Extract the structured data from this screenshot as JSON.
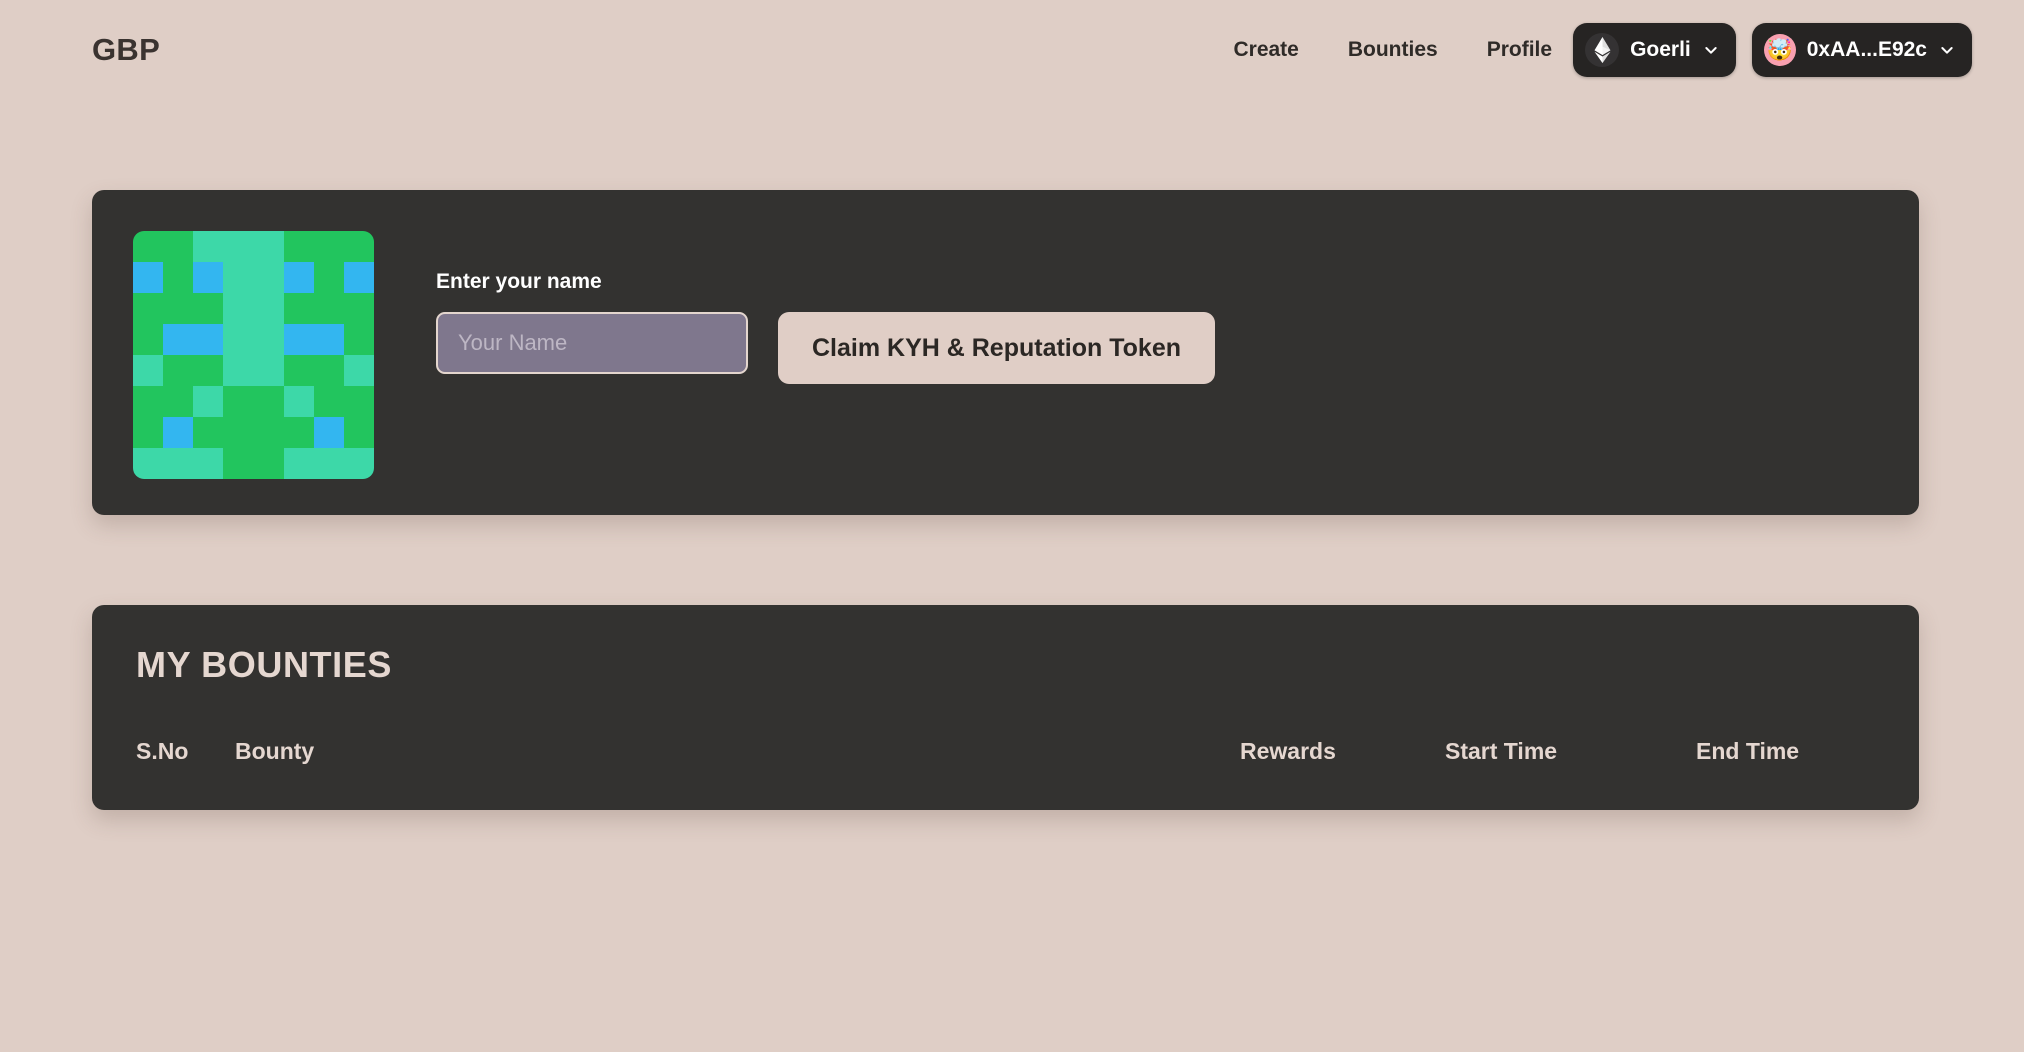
{
  "brand": {
    "name": "GBP"
  },
  "nav": {
    "links": [
      {
        "label": "Create",
        "name": "create"
      },
      {
        "label": "Bounties",
        "name": "bounties"
      },
      {
        "label": "Profile",
        "name": "profile"
      }
    ],
    "network_chip": {
      "label": "Goerli",
      "icon": "ethereum-icon",
      "chevron": "chevron-down-icon"
    },
    "account_chip": {
      "label": "0xAA...E92c",
      "avatar_emoji": "🤯",
      "chevron": "chevron-down-icon"
    }
  },
  "profile_card": {
    "identicon": {
      "colors": {
        "green": "#22c55e",
        "blue": "#33b6f0",
        "mint": "#3dd8a8"
      },
      "grid": [
        [
          "green",
          "green",
          "mint",
          "mint",
          "mint",
          "green",
          "green",
          "green"
        ],
        [
          "blue",
          "green",
          "blue",
          "mint",
          "mint",
          "blue",
          "green",
          "blue"
        ],
        [
          "green",
          "green",
          "green",
          "mint",
          "mint",
          "green",
          "green",
          "green"
        ],
        [
          "green",
          "blue",
          "blue",
          "mint",
          "mint",
          "blue",
          "blue",
          "green"
        ],
        [
          "mint",
          "green",
          "green",
          "mint",
          "mint",
          "green",
          "green",
          "mint"
        ],
        [
          "green",
          "green",
          "mint",
          "green",
          "green",
          "mint",
          "green",
          "green"
        ],
        [
          "green",
          "blue",
          "green",
          "green",
          "green",
          "green",
          "blue",
          "green"
        ],
        [
          "mint",
          "mint",
          "mint",
          "green",
          "green",
          "mint",
          "mint",
          "mint"
        ]
      ]
    },
    "name_label": "Enter your name",
    "name_placeholder": "Your Name",
    "name_value": "",
    "claim_button": "Claim KYH & Reputation Token"
  },
  "bounties": {
    "title": "MY BOUNTIES",
    "columns": {
      "sno": "S.No",
      "bounty": "Bounty",
      "rewards": "Rewards",
      "start_time": "Start Time",
      "end_time": "End Time"
    },
    "rows": []
  },
  "theme": {
    "background": "#dfcec6",
    "card": "#333230",
    "accent_cream": "#e0cec6",
    "chip_dark": "#262423",
    "input_purple": "#7f778d"
  }
}
